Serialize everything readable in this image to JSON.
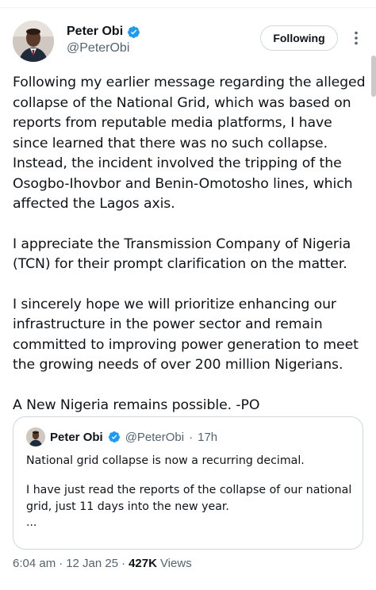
{
  "author": {
    "display_name": "Peter Obi",
    "handle": "@PeterObi",
    "verified_icon": "verified-badge-icon",
    "badge_color": "#1d9bf0"
  },
  "actions": {
    "follow_label": "Following",
    "more_icon": "more-options-icon"
  },
  "tweet": {
    "paragraphs": [
      "Following my earlier message regarding the alleged collapse of the National Grid, which was based on reports from reputable media platforms, I have since learned that there was no such collapse. Instead, the incident involved the tripping of the Osogbo-Ihovbor and Benin-Omotosho lines, which affected the Lagos axis.",
      "I appreciate the Transmission Company of Nigeria (TCN) for their prompt clarification on the matter.",
      "I sincerely hope we will prioritize enhancing our infrastructure in the power sector and remain committed to improving power generation to meet the growing needs of over 200 million Nigerians.",
      "A New Nigeria remains possible. -PO"
    ]
  },
  "quote": {
    "display_name": "Peter Obi",
    "handle": "@PeterObi",
    "dot": "·",
    "time": "17h",
    "paragraphs": [
      "National grid collapse is now a recurring decimal.",
      "I have just read the reports of the collapse of our national grid, just 11 days into the new year."
    ],
    "ellipsis": "..."
  },
  "meta": {
    "time": "6:04 am",
    "date": "12 Jan 25",
    "separator": "·",
    "views_count": "427K",
    "views_label": "Views"
  },
  "colors": {
    "text": "#0f1419",
    "secondary": "#536471",
    "border": "#cfd9de"
  }
}
